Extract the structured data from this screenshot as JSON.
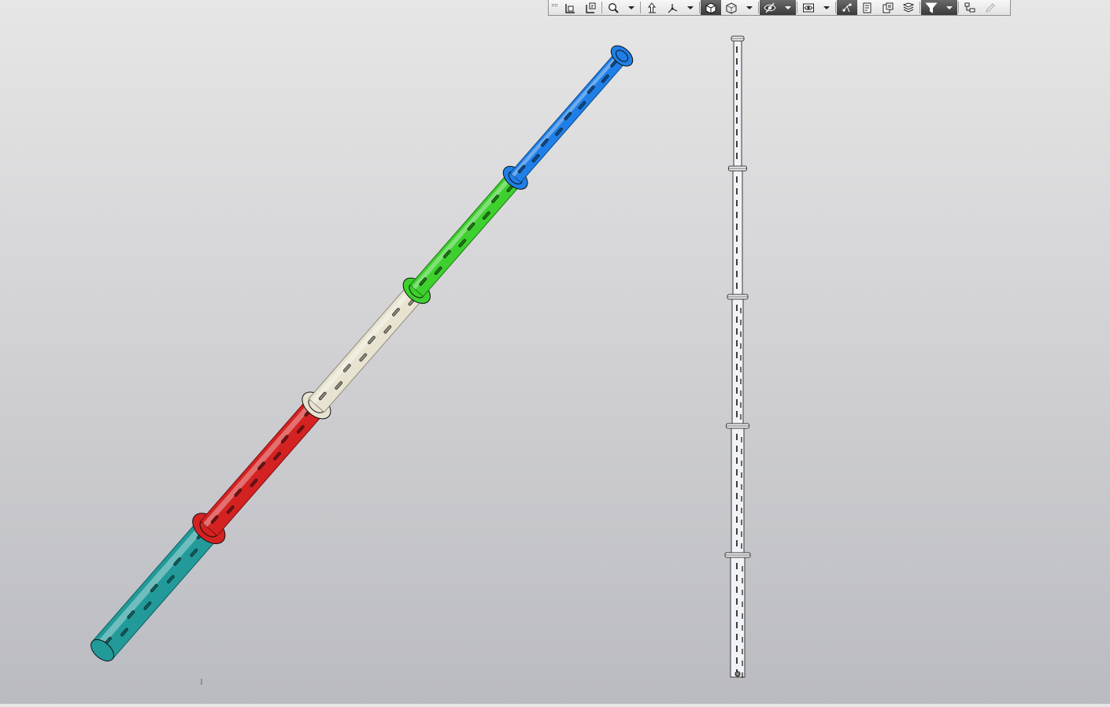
{
  "window": {
    "type": "3D CAD graphics viewport"
  },
  "toolbar": {
    "buttons": [
      {
        "name": "toolbar-grip",
        "icon": "grip-icon",
        "kind": "grip"
      },
      {
        "name": "zoom-to-fit-button",
        "icon": "zoom-to-fit-icon",
        "kind": "w"
      },
      {
        "name": "zoom-area-button",
        "icon": "zoom-area-icon",
        "kind": "w"
      },
      {
        "name": "zoom-button",
        "icon": "magnifier-icon",
        "kind": "w"
      },
      {
        "name": "zoom-dropdown",
        "icon": "chevron-down-icon",
        "kind": "dd"
      },
      {
        "name": "previous-view-button",
        "icon": "previous-view-icon",
        "kind": "w"
      },
      {
        "name": "section-view-button",
        "icon": "section-view-icon",
        "kind": "w"
      },
      {
        "name": "section-view-dropdown",
        "icon": "chevron-down-icon",
        "kind": "dd"
      },
      {
        "name": "view-orientation-button",
        "icon": "cube-solid-icon",
        "kind": "w",
        "active": true
      },
      {
        "name": "display-style-button",
        "icon": "cube-wireframe-icon",
        "kind": "w"
      },
      {
        "name": "display-style-dropdown",
        "icon": "chevron-down-icon",
        "kind": "dd"
      },
      {
        "name": "hide-show-items-button",
        "icon": "eye-hide-icon",
        "kind": "w",
        "active": true
      },
      {
        "name": "hide-show-dropdown",
        "icon": "chevron-down-icon",
        "kind": "dd",
        "active": true
      },
      {
        "name": "edit-appearance-button",
        "icon": "eye-appearance-icon",
        "kind": "w"
      },
      {
        "name": "edit-appearance-dropdown",
        "icon": "chevron-down-icon",
        "kind": "dd"
      },
      {
        "name": "apply-scene-button",
        "icon": "scene-icon",
        "kind": "w",
        "active": true
      },
      {
        "name": "view-settings-button",
        "icon": "document-settings-icon",
        "kind": "w"
      },
      {
        "name": "display-pane-button",
        "icon": "layers-icon",
        "kind": "w"
      },
      {
        "name": "realview-button",
        "icon": "stack-icon",
        "kind": "w"
      },
      {
        "name": "selection-filter-button",
        "icon": "filter-icon",
        "kind": "w",
        "active": true
      },
      {
        "name": "selection-filter-dropdown",
        "icon": "chevron-down-icon",
        "kind": "dd",
        "active": true
      },
      {
        "name": "tree-display-button",
        "icon": "tree-icon",
        "kind": "w"
      },
      {
        "name": "measure-button",
        "icon": "pencil-icon",
        "kind": "w",
        "disabled": true
      }
    ]
  },
  "model": {
    "iso_view": {
      "sections": [
        {
          "name": "segment-teal",
          "color": "#229a9a",
          "dark": "#0f5f5f"
        },
        {
          "name": "segment-red",
          "color": "#d42222",
          "dark": "#7a0f0f"
        },
        {
          "name": "segment-cream",
          "color": "#e8e3d1",
          "dark": "#8e8a7c"
        },
        {
          "name": "segment-green",
          "color": "#3ed02e",
          "dark": "#1a7a12"
        },
        {
          "name": "segment-blue",
          "color": "#1f7fe6",
          "dark": "#0c4a8e"
        }
      ]
    },
    "front_view": {
      "fill": "#f2f3f7",
      "stroke": "#3a3a3a"
    }
  },
  "colors": {
    "background_top": "#e6e6e6",
    "background_bottom": "#babbc1",
    "toolbar_active": "#3a3a3a"
  }
}
